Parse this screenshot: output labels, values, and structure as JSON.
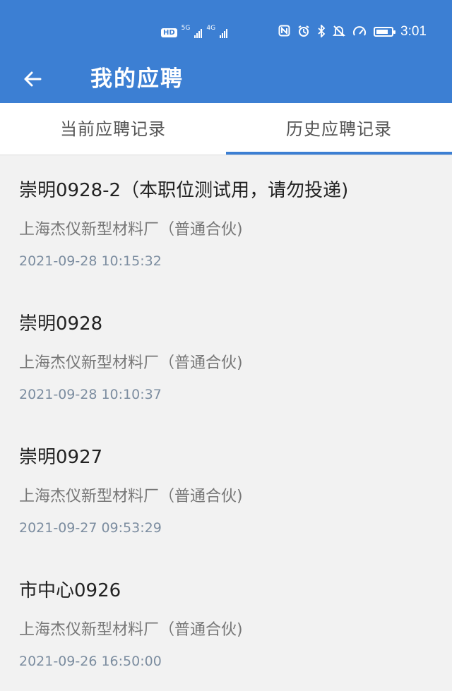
{
  "status_bar": {
    "network_badge": "HD",
    "sim1_network": "5G",
    "sim2_network": "4G",
    "icons": [
      "nfc-icon",
      "alarm-icon",
      "bluetooth-icon",
      "mute-icon",
      "data-saver-icon",
      "battery-icon"
    ],
    "battery_level": 0.8,
    "time": "3:01"
  },
  "header": {
    "title": "我的应聘",
    "back_icon": "arrow-left-icon",
    "color": "#3c7fd3"
  },
  "tabs": [
    {
      "label": "当前应聘记录",
      "active": false
    },
    {
      "label": "历史应聘记录",
      "active": true
    }
  ],
  "records": [
    {
      "title": "崇明0928-2（本职位测试用，请勿投递)",
      "company": "上海杰仪新型材料厂（普通合伙)",
      "date": "2021-09-28 10:15:32"
    },
    {
      "title": "崇明0928",
      "company": "上海杰仪新型材料厂（普通合伙)",
      "date": "2021-09-28 10:10:37"
    },
    {
      "title": "崇明0927",
      "company": "上海杰仪新型材料厂（普通合伙)",
      "date": "2021-09-27 09:53:29"
    },
    {
      "title": "市中心0926",
      "company": "上海杰仪新型材料厂（普通合伙)",
      "date": "2021-09-26 16:50:00"
    }
  ]
}
